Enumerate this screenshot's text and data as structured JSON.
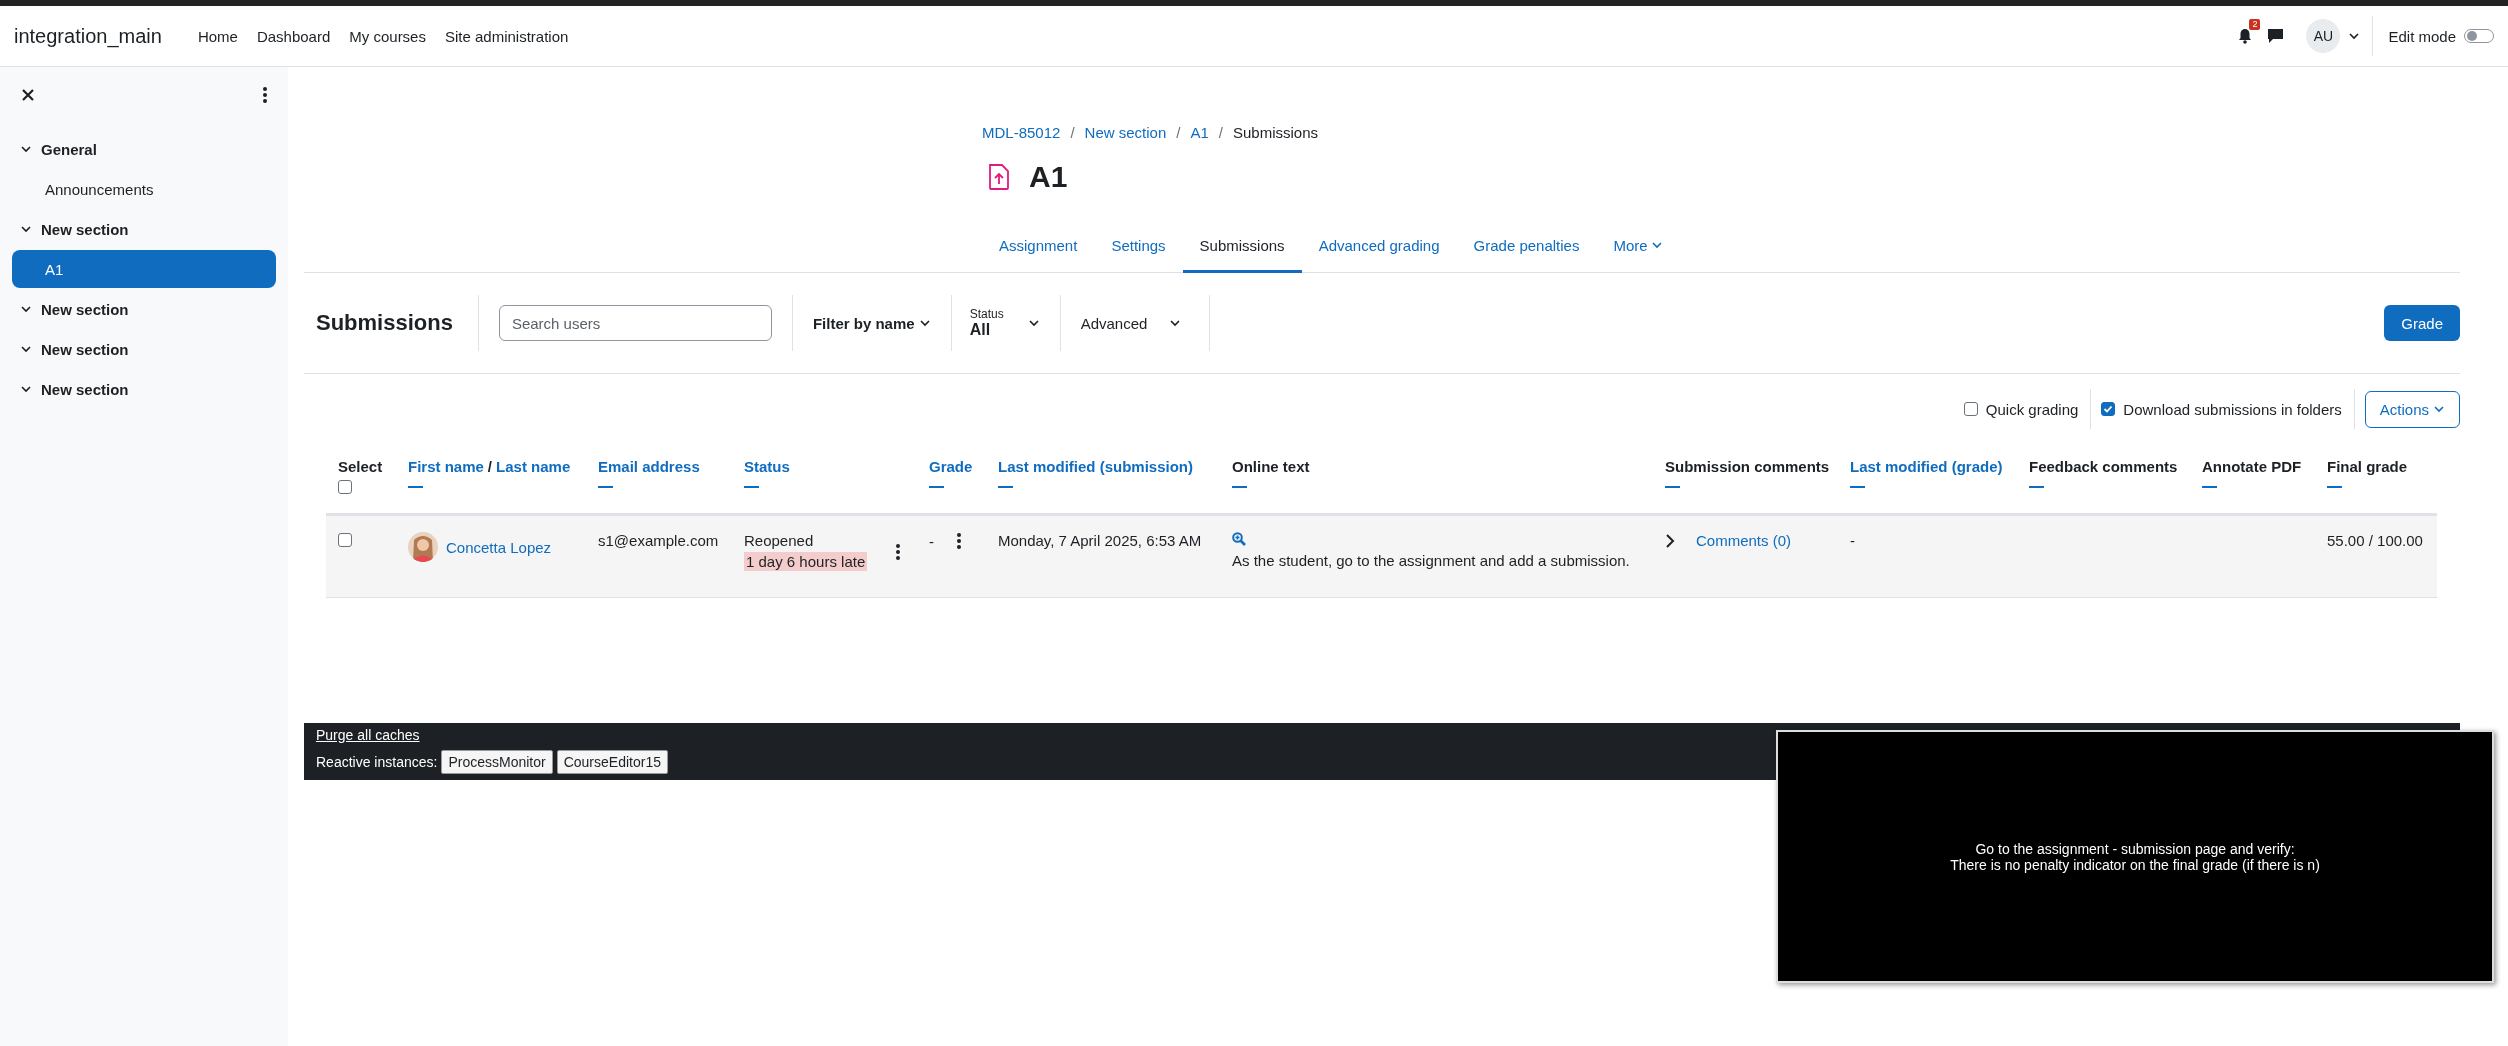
{
  "top_bar": {
    "site_name": "integration_main",
    "nav": [
      {
        "label": "Home"
      },
      {
        "label": "Dashboard"
      },
      {
        "label": "My courses"
      },
      {
        "label": "Site administration"
      }
    ],
    "notification_count": "2",
    "user_initials": "AU",
    "edit_mode": {
      "label": "Edit mode",
      "on": false
    }
  },
  "sidebar": {
    "items": [
      {
        "label": "General",
        "expanded": true,
        "children": [
          {
            "label": "Announcements",
            "selected": false
          }
        ]
      },
      {
        "label": "New section",
        "expanded": true,
        "children": [
          {
            "label": "A1",
            "selected": true
          }
        ]
      },
      {
        "label": "New section",
        "expanded": true
      },
      {
        "label": "New section",
        "expanded": true
      },
      {
        "label": "New section",
        "expanded": true
      }
    ]
  },
  "breadcrumb": [
    "MDL-85012",
    "New section",
    "A1",
    "Submissions"
  ],
  "breadcrumb_separator": "/",
  "page_title": "A1",
  "tabs": [
    {
      "label": "Assignment",
      "selected": false,
      "kind": "link"
    },
    {
      "label": "Settings",
      "selected": false,
      "kind": "link"
    },
    {
      "label": "Submissions",
      "selected": true,
      "kind": "link"
    },
    {
      "label": "Advanced grading",
      "selected": false,
      "kind": "link"
    },
    {
      "label": "Grade penalties",
      "selected": false,
      "kind": "link"
    },
    {
      "label": "More",
      "selected": false,
      "kind": "dropdown"
    }
  ],
  "toolbar": {
    "heading": "Submissions",
    "search": {
      "placeholder": "Search users"
    },
    "filter_by_name": "Filter by name",
    "status": {
      "label": "Status",
      "value": "All"
    },
    "advanced": "Advanced",
    "grade_button": "Grade"
  },
  "options": {
    "checkboxes": [
      {
        "label": "Quick grading",
        "checked": false
      },
      {
        "label": "Download submissions in folders",
        "checked": true
      }
    ],
    "actions": "Actions"
  },
  "table": {
    "select_all_checked": false,
    "columns": [
      {
        "label": "Select",
        "kind": "select"
      },
      {
        "parts": [
          "First name",
          "Last name"
        ],
        "separator": "/",
        "kind": "sortable"
      },
      {
        "label": "Email address",
        "kind": "sortable"
      },
      {
        "label": "Status",
        "kind": "sortable"
      },
      {
        "label": "Grade",
        "kind": "sortable"
      },
      {
        "label": "Last modified (submission)",
        "kind": "sortable"
      },
      {
        "label": "Online text",
        "kind": "plain"
      },
      {
        "label": "Submission comments",
        "kind": "plain"
      },
      {
        "label": "Last modified (grade)",
        "kind": "sortable"
      },
      {
        "label": "Feedback comments",
        "kind": "plain"
      },
      {
        "label": "Annotate PDF",
        "kind": "plain"
      },
      {
        "label": "Final grade",
        "kind": "plain"
      }
    ],
    "rows": [
      {
        "checked": false,
        "name": "Concetta Lopez",
        "email": "s1@example.com",
        "status": "Reopened",
        "status_note": "1 day 6 hours late",
        "grade": "-",
        "last_modified": "Monday, 7 April 2025, 6:53 AM",
        "online_text": "As the student, go to the assignment and add a submission.",
        "comments": "Comments (0)",
        "last_modified_grade": "-",
        "final_grade": "55.00 / 100.00"
      }
    ]
  },
  "footer": {
    "purge": "Purge all caches",
    "reactive_label": "Reactive instances:",
    "instances": [
      "ProcessMonitor",
      "CourseEditor15"
    ]
  },
  "overlay": {
    "lines": [
      "Go to the assignment - submission page and verify:",
      "There is no penalty indicator on the final grade (if there is n)"
    ]
  }
}
